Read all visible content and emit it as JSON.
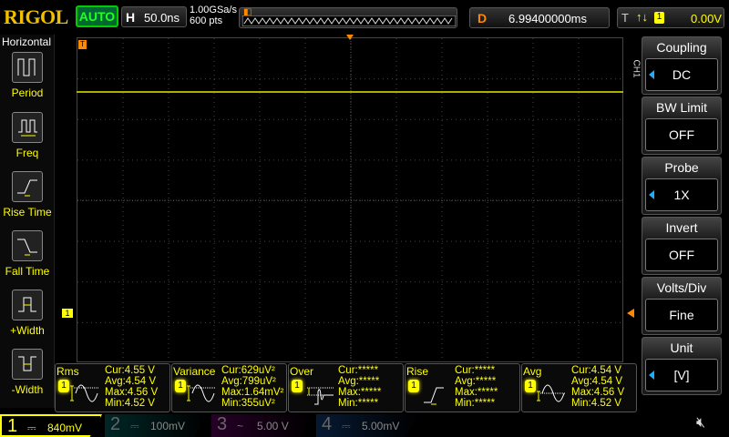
{
  "header": {
    "logo": "RIGOL",
    "run_mode": "AUTO",
    "h_label": "H",
    "timebase": "50.0ns",
    "sample_rate": "1.00GSa/s",
    "points": "600 pts",
    "delay_label": "D",
    "delay": "6.99400000ms",
    "trig_label": "T",
    "trig_slope": "↑↓",
    "trig_source": "1",
    "trig_level": "0.00V"
  },
  "left_menu": {
    "title": "Horizontal",
    "items": [
      {
        "label": "Period"
      },
      {
        "label": "Freq"
      },
      {
        "label": "Rise Time"
      },
      {
        "label": "Fall Time"
      },
      {
        "label": "+Width"
      },
      {
        "label": "-Width"
      }
    ]
  },
  "right_menu": {
    "channel": "CH1",
    "items": [
      {
        "title": "Coupling",
        "value": "DC",
        "arrow": true
      },
      {
        "title": "BW Limit",
        "value": "OFF",
        "arrow": false
      },
      {
        "title": "Probe",
        "value": "1X",
        "arrow": true
      },
      {
        "title": "Invert",
        "value": "OFF",
        "arrow": false
      },
      {
        "title": "Volts/Div",
        "value": "Fine",
        "arrow": false
      },
      {
        "title": "Unit",
        "value": "[V]",
        "arrow": true
      }
    ]
  },
  "markers": {
    "ch1": "1",
    "trigger": "T"
  },
  "measurements": [
    {
      "name": "Rms",
      "src": "1",
      "cur": "Cur:4.55 V",
      "avg": "Avg:4.54 V",
      "max": "Max:4.56 V",
      "min": "Min:4.52 V"
    },
    {
      "name": "Variance",
      "src": "1",
      "cur": "Cur:629uV²",
      "avg": "Avg:799uV²",
      "max": "Max:1.64mV²",
      "min": "Min:355uV²"
    },
    {
      "name": "Over",
      "src": "1",
      "cur": "Cur:*****",
      "avg": "Avg:*****",
      "max": "Max:*****",
      "min": "Min:*****"
    },
    {
      "name": "Rise",
      "src": "1",
      "cur": "Cur:*****",
      "avg": "Avg:*****",
      "max": "Max:*****",
      "min": "Min:*****"
    },
    {
      "name": "Avg",
      "src": "1",
      "cur": "Cur:4.54 V",
      "avg": "Avg:4.54 V",
      "max": "Max:4.56 V",
      "min": "Min:4.52 V"
    }
  ],
  "channels": [
    {
      "num": "1",
      "coupling": "⎓",
      "scale": "840mV",
      "color": "#ffff00"
    },
    {
      "num": "2",
      "coupling": "⎓",
      "scale": "100mV",
      "color": "#00c0c0"
    },
    {
      "num": "3",
      "coupling": "~",
      "scale": "5.00 V",
      "color": "#c000c0"
    },
    {
      "num": "4",
      "coupling": "⎓",
      "scale": "5.00mV",
      "color": "#2080ff"
    }
  ],
  "colors": {
    "ch1": "#ffff00",
    "trigger": "#ff8000",
    "accent": "#22aaff"
  }
}
